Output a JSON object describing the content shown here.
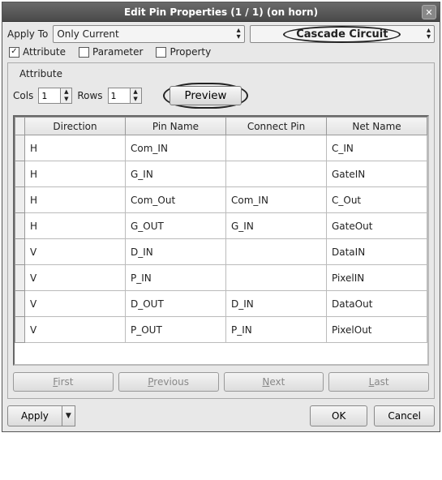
{
  "window": {
    "title": "Edit Pin Properties (1 / 1) (on horn)"
  },
  "applyTo": {
    "label": "Apply To",
    "value": "Only Current"
  },
  "cascade": {
    "label": "Cascade Circuit"
  },
  "checks": {
    "attribute": "Attribute",
    "parameter": "Parameter",
    "property": "Property"
  },
  "frame": {
    "title": "Attribute",
    "colsLabel": "Cols",
    "colsValue": "1",
    "rowsLabel": "Rows",
    "rowsValue": "1",
    "preview": "Preview"
  },
  "table": {
    "headers": {
      "direction": "Direction",
      "pinName": "Pin Name",
      "connectPin": "Connect Pin",
      "netName": "Net Name"
    },
    "rows": [
      {
        "dir": "H",
        "pin": "Com_IN",
        "conn": "",
        "net": "C_IN"
      },
      {
        "dir": "H",
        "pin": "G_IN",
        "conn": "",
        "net": "GateIN"
      },
      {
        "dir": "H",
        "pin": "Com_Out",
        "conn": "Com_IN",
        "net": "C_Out"
      },
      {
        "dir": "H",
        "pin": "G_OUT",
        "conn": "G_IN",
        "net": "GateOut"
      },
      {
        "dir": "V",
        "pin": "D_IN",
        "conn": "",
        "net": "DataIN"
      },
      {
        "dir": "V",
        "pin": "P_IN",
        "conn": "",
        "net": "PixelIN"
      },
      {
        "dir": "V",
        "pin": "D_OUT",
        "conn": "D_IN",
        "net": "DataOut"
      },
      {
        "dir": "V",
        "pin": "P_OUT",
        "conn": "P_IN",
        "net": "PixelOut"
      }
    ]
  },
  "nav": {
    "first": "First",
    "previous": "Previous",
    "next": "Next",
    "last": "Last"
  },
  "buttons": {
    "apply": "Apply",
    "ok": "OK",
    "cancel": "Cancel"
  }
}
